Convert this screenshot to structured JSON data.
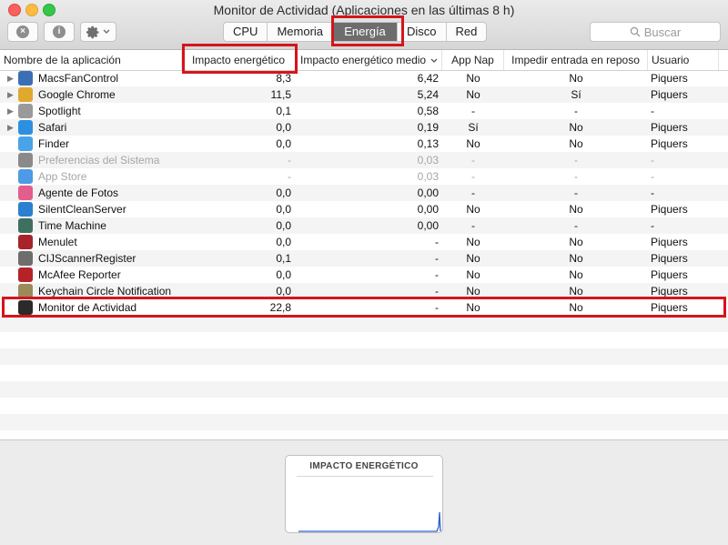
{
  "window": {
    "title": "Monitor de Actividad (Aplicaciones en las últimas 8 h)"
  },
  "toolbar": {
    "tabs": [
      {
        "label": "CPU"
      },
      {
        "label": "Memoria"
      },
      {
        "label": "Energía"
      },
      {
        "label": "Disco"
      },
      {
        "label": "Red"
      }
    ],
    "active_tab": "Energía",
    "search_placeholder": "Buscar",
    "icons": {
      "stop": "x-circle-icon",
      "info": "info-icon",
      "action": "gear-icon"
    },
    "info_glyph": "i"
  },
  "table": {
    "columns": [
      "Nombre de la aplicación",
      "Impacto energético",
      "Impacto energético medio",
      "App Nap",
      "Impedir entrada en reposo",
      "Usuario"
    ],
    "rows": [
      {
        "name": "MacsFanControl",
        "impact": "8,3",
        "avg": "6,42",
        "nap": "No",
        "sleep": "No",
        "user": "Piquers",
        "icon_color": "#3a6fb5",
        "expand": true,
        "dim": false
      },
      {
        "name": "Google Chrome",
        "impact": "11,5",
        "avg": "5,24",
        "nap": "No",
        "sleep": "Sí",
        "user": "Piquers",
        "icon_color": "#e0a82e",
        "expand": true,
        "dim": false
      },
      {
        "name": "Spotlight",
        "impact": "0,1",
        "avg": "0,58",
        "nap": "-",
        "sleep": "-",
        "user": "-",
        "icon_color": "#9a9a9a",
        "expand": true,
        "dim": false
      },
      {
        "name": "Safari",
        "impact": "0,0",
        "avg": "0,19",
        "nap": "Sí",
        "sleep": "No",
        "user": "Piquers",
        "icon_color": "#2d8fe0",
        "expand": true,
        "dim": false
      },
      {
        "name": "Finder",
        "impact": "0,0",
        "avg": "0,13",
        "nap": "No",
        "sleep": "No",
        "user": "Piquers",
        "icon_color": "#4aa3e8",
        "expand": false,
        "dim": false
      },
      {
        "name": "Preferencias del Sistema",
        "impact": "-",
        "avg": "0,03",
        "nap": "-",
        "sleep": "-",
        "user": "-",
        "icon_color": "#8a8a8a",
        "expand": false,
        "dim": true
      },
      {
        "name": "App Store",
        "impact": "-",
        "avg": "0,03",
        "nap": "-",
        "sleep": "-",
        "user": "-",
        "icon_color": "#4d9ae6",
        "expand": false,
        "dim": true
      },
      {
        "name": "Agente de Fotos",
        "impact": "0,0",
        "avg": "0,00",
        "nap": "-",
        "sleep": "-",
        "user": "-",
        "icon_color": "#e35d8d",
        "expand": false,
        "dim": false
      },
      {
        "name": "SilentCleanServer",
        "impact": "0,0",
        "avg": "0,00",
        "nap": "No",
        "sleep": "No",
        "user": "Piquers",
        "icon_color": "#2b7fd1",
        "expand": false,
        "dim": false
      },
      {
        "name": "Time Machine",
        "impact": "0,0",
        "avg": "0,00",
        "nap": "-",
        "sleep": "-",
        "user": "-",
        "icon_color": "#3f6f5f",
        "expand": false,
        "dim": false
      },
      {
        "name": "Menulet",
        "impact": "0,0",
        "avg": "-",
        "nap": "No",
        "sleep": "No",
        "user": "Piquers",
        "icon_color": "#a8232a",
        "expand": false,
        "dim": false
      },
      {
        "name": "CIJScannerRegister",
        "impact": "0,1",
        "avg": "-",
        "nap": "No",
        "sleep": "No",
        "user": "Piquers",
        "icon_color": "#6d6d6d",
        "expand": false,
        "dim": false
      },
      {
        "name": "McAfee Reporter",
        "impact": "0,0",
        "avg": "-",
        "nap": "No",
        "sleep": "No",
        "user": "Piquers",
        "icon_color": "#b52228",
        "expand": false,
        "dim": false
      },
      {
        "name": "Keychain Circle Notification",
        "impact": "0,0",
        "avg": "-",
        "nap": "No",
        "sleep": "No",
        "user": "Piquers",
        "icon_color": "#9b8a5a",
        "expand": false,
        "dim": false
      },
      {
        "name": "Monitor de Actividad",
        "impact": "22,8",
        "avg": "-",
        "nap": "No",
        "sleep": "No",
        "user": "Piquers",
        "icon_color": "#2a2a2a",
        "expand": false,
        "dim": false
      }
    ],
    "empty_rows": 8
  },
  "graph": {
    "title": "IMPACTO ENERGÉTICO",
    "line_color": "#2f5fd0"
  },
  "highlight_color": "#d5141c"
}
